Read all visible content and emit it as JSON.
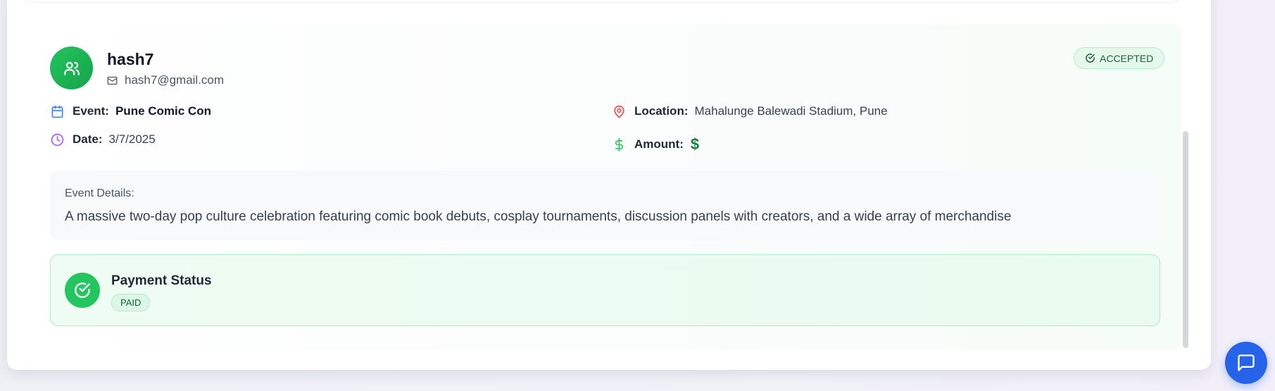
{
  "booking": {
    "username": "hash7",
    "email": "hash7@gmail.com",
    "status": "ACCEPTED",
    "event_label": "Event:",
    "event_name": "Pune Comic Con",
    "date_label": "Date:",
    "date_value": "3/7/2025",
    "location_label": "Location:",
    "location_value": "Mahalunge Balewadi Stadium, Pune",
    "amount_label": "Amount:",
    "amount_value": "$",
    "details_label": "Event Details:",
    "details_text": "A massive two-day pop culture celebration featuring comic book debuts, cosplay tournaments, discussion panels with creators, and a wide array of merchandise",
    "payment_title": "Payment Status",
    "payment_status": "PAID"
  },
  "icons": {
    "avatar": "users-icon",
    "email": "mail-icon",
    "status": "check-circle-icon",
    "event": "calendar-icon",
    "date": "clock-icon",
    "location": "map-pin-icon",
    "amount": "dollar-icon",
    "payment": "check-circle-icon",
    "chat": "chat-bubble-icon"
  },
  "colors": {
    "accent_green": "#22c55e",
    "badge_green_text": "#166534",
    "chat_blue": "#2563eb",
    "calendar_blue": "#3b82f6",
    "clock_purple": "#a855f7",
    "pin_red": "#ef4444"
  }
}
